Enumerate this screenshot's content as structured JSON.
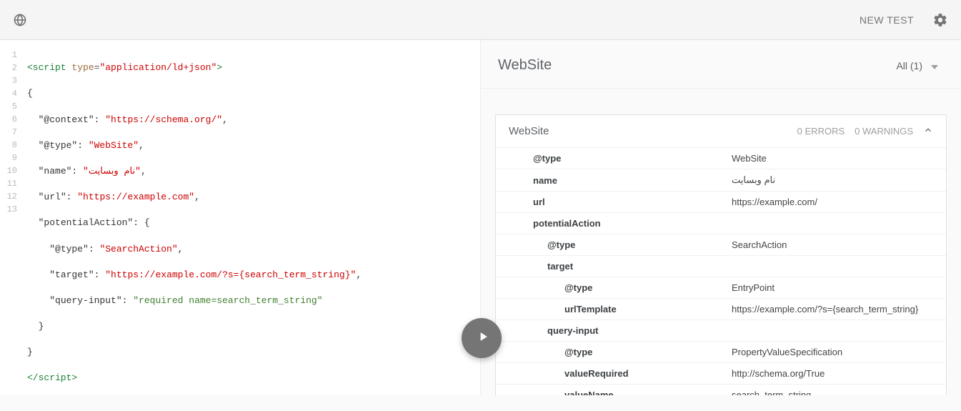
{
  "topbar": {
    "new_test_label": "NEW TEST"
  },
  "code": {
    "lines_count": 13,
    "l1_open": "<script",
    "l1_attr": " type",
    "l1_eq": "=",
    "l1_val": "\"application/ld+json\"",
    "l1_close": ">",
    "l2": "{",
    "l3_k": "\"@context\"",
    "l3_v": "\"https://schema.org/\"",
    "l4_k": "\"@type\"",
    "l4_v": "\"WebSite\"",
    "l5_k": "\"name\"",
    "l5_v": "\"نام وبسایت\"",
    "l6_k": "\"url\"",
    "l6_v": "\"https://example.com\"",
    "l7_k": "\"potentialAction\"",
    "l7_v": "{",
    "l8_k": "\"@type\"",
    "l8_v": "\"SearchAction\"",
    "l9_k": "\"target\"",
    "l9_v": "\"https://example.com/?s={search_term_string}\"",
    "l10_k": "\"query-input\"",
    "l10_v": "\"required name=search_term_string\"",
    "l11": "}",
    "l12": "}",
    "l13": "</script>"
  },
  "results": {
    "title": "WebSite",
    "filter_label": "All (1)",
    "entity": {
      "name": "WebSite",
      "errors": "0 ERRORS",
      "warnings": "0 WARNINGS",
      "rows": [
        {
          "key": "@type",
          "value": "WebSite",
          "indent": 1
        },
        {
          "key": "name",
          "value": "نام وبسایت",
          "indent": 1
        },
        {
          "key": "url",
          "value": "https://example.com/",
          "indent": 1
        },
        {
          "key": "potentialAction",
          "value": "",
          "indent": 1
        },
        {
          "key": "@type",
          "value": "SearchAction",
          "indent": 2
        },
        {
          "key": "target",
          "value": "",
          "indent": 2
        },
        {
          "key": "@type",
          "value": "EntryPoint",
          "indent": 3
        },
        {
          "key": "urlTemplate",
          "value": "https://example.com/?s={search_term_string}",
          "indent": 3
        },
        {
          "key": "query-input",
          "value": "",
          "indent": 2
        },
        {
          "key": "@type",
          "value": "PropertyValueSpecification",
          "indent": 3
        },
        {
          "key": "valueRequired",
          "value": "http://schema.org/True",
          "indent": 3
        },
        {
          "key": "valueName",
          "value": "search_term_string",
          "indent": 3
        }
      ]
    }
  },
  "gutter": [
    "1",
    "2",
    "3",
    "4",
    "5",
    "6",
    "7",
    "8",
    "9",
    "10",
    "11",
    "12",
    "13"
  ]
}
